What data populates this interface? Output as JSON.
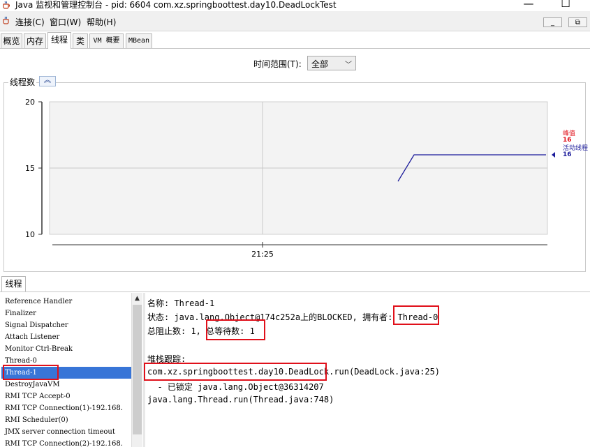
{
  "window": {
    "title": "Java 监视和管理控制台 - pid: 6604 com.xz.springboottest.day10.DeadLockTest",
    "minimize": "—",
    "maximize": "☐"
  },
  "menu": {
    "items": [
      "连接(C)",
      "窗口(W)",
      "帮助(H)"
    ],
    "mdi_min": "_",
    "mdi_restore": "⧉"
  },
  "tabs": [
    "概览",
    "内存",
    "线程",
    "类",
    "VM 概要",
    "MBean"
  ],
  "active_tab": "线程",
  "time_range": {
    "label": "时间范围(T):",
    "value": "全部"
  },
  "chart_panel": {
    "title": "线程数",
    "collapse_icon": "chevrons-up-icon"
  },
  "chart_data": {
    "type": "line",
    "title": "线程数",
    "ylim": [
      10,
      20
    ],
    "yticks": [
      "20",
      "15",
      "10"
    ],
    "xticks": [
      "21:25"
    ],
    "series": [
      {
        "name": "峰值",
        "color": "#e0101a",
        "values": [
          16
        ]
      },
      {
        "name": "活动线程",
        "color": "#1a1a9a",
        "points": [
          [
            0,
            14
          ],
          [
            1,
            16
          ],
          [
            2,
            16
          ]
        ]
      }
    ],
    "legend": [
      {
        "label": "峰值",
        "value": "16",
        "color": "#e0101a"
      },
      {
        "label": "活动线程",
        "value": "16",
        "color": "#1a1a9a"
      }
    ]
  },
  "threads_section": {
    "tab_label": "线程",
    "list": [
      "Reference Handler",
      "Finalizer",
      "Signal Dispatcher",
      "Attach Listener",
      "Monitor Ctrl-Break",
      "Thread-0",
      "Thread-1",
      "DestroyJavaVM",
      "RMI TCP Accept-0",
      "RMI TCP Connection(1)-192.168.",
      "RMI Scheduler(0)",
      "JMX server connection timeout",
      "RMI TCP Connection(2)-192.168."
    ],
    "selected": "Thread-1",
    "details": {
      "name_line": "名称: Thread-1",
      "state_prefix": "状态: java.lang.Object@174c252a上的BLOCKED, 拥有者: ",
      "owner": "Thread-0",
      "blocked_prefix": "总阻止数: 1, ",
      "waited": "总等待数: 1",
      "stack_label": "堆栈跟踪:",
      "stack_class": "com.xz.springboottest.day10.DeadLock.",
      "stack_method": "run(DeadLock.java:25)",
      "locked_line": "  - 已锁定 java.lang.Object@36314207",
      "thread_run_line": "java.lang.Thread.run(Thread.java:748)"
    }
  }
}
